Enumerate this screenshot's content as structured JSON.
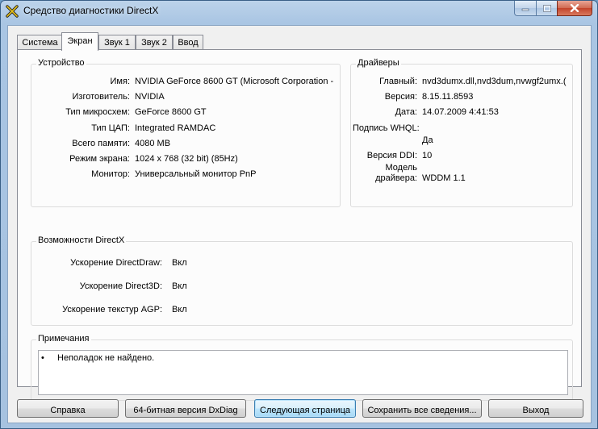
{
  "window": {
    "title": "Средство диагностики DirectX"
  },
  "tabs": [
    {
      "label": "Система"
    },
    {
      "label": "Экран"
    },
    {
      "label": "Звук 1"
    },
    {
      "label": "Звук 2"
    },
    {
      "label": "Ввод"
    }
  ],
  "active_tab": "Экран",
  "device": {
    "title": "Устройство",
    "rows": [
      {
        "label": "Имя:",
        "value": "NVIDIA GeForce 8600 GT (Microsoft Corporation -"
      },
      {
        "label": "Изготовитель:",
        "value": "NVIDIA"
      },
      {
        "label": "Тип микросхем:",
        "value": "GeForce 8600 GT"
      },
      {
        "label": "Тип ЦАП:",
        "value": "Integrated RAMDAC"
      },
      {
        "label": "Всего памяти:",
        "value": "4080 MB"
      },
      {
        "label": "Режим экрана:",
        "value": "1024 x 768 (32 bit) (85Hz)"
      },
      {
        "label": "Монитор:",
        "value": "Универсальный монитор PnP"
      }
    ]
  },
  "drivers": {
    "title": "Драйверы",
    "main_label": "Главный:",
    "main_value": "nvd3dumx.dll,nvd3dum,nvwgf2umx.(",
    "version_label": "Версия:",
    "version_value": "8.15.11.8593",
    "date_label": "Дата:",
    "date_value": "14.07.2009 4:41:53",
    "whql_label": "Подпись WHQL:",
    "whql_value": "Да",
    "ddi_label": "Версия DDI:",
    "ddi_value": "10",
    "model_label_line1": "Модель",
    "model_label_line2": "драйвера:",
    "model_value": "WDDM 1.1"
  },
  "features": {
    "title": "Возможности DirectX",
    "rows": [
      {
        "label": "Ускорение DirectDraw:",
        "value": "Вкл"
      },
      {
        "label": "Ускорение Direct3D:",
        "value": "Вкл"
      },
      {
        "label": "Ускорение текстур AGP:",
        "value": "Вкл"
      }
    ]
  },
  "notes": {
    "title": "Примечания",
    "bullet": "•",
    "text": "Неполадок не найдено."
  },
  "buttons": {
    "help": "Справка",
    "dxdiag64": "64-битная версия DxDiag",
    "next_page": "Следующая страница",
    "save_all": "Сохранить все сведения...",
    "exit": "Выход"
  }
}
